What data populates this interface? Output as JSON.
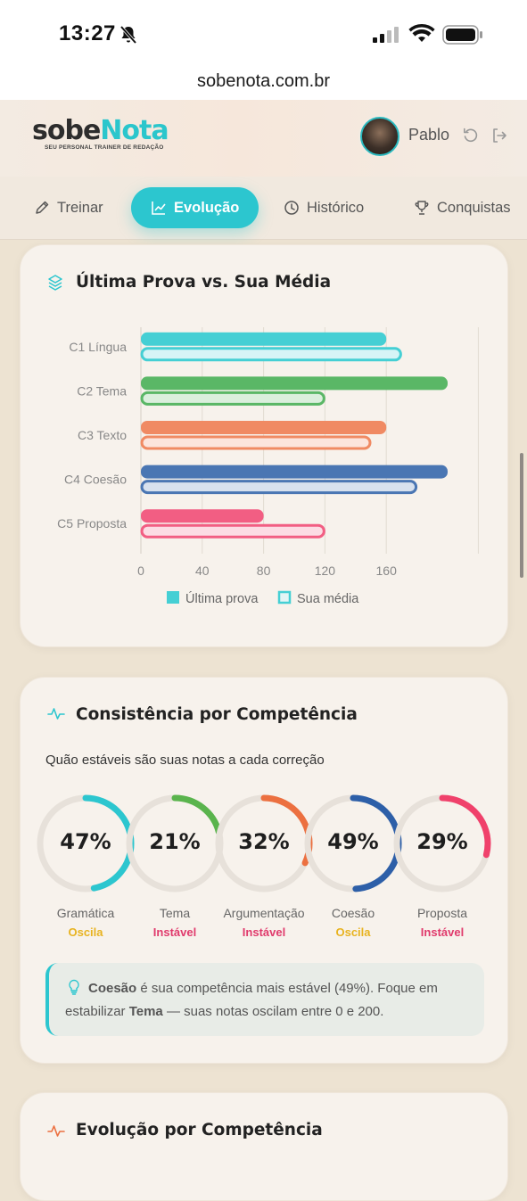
{
  "status_bar": {
    "time": "13:27"
  },
  "browser": {
    "url": "sobenota.com.br"
  },
  "header": {
    "logo_sobe": "sobe",
    "logo_nota": "Nota",
    "logo_tagline": "SEU PERSONAL TRAINER DE REDAÇÃO",
    "user_name": "Pablo"
  },
  "tabs": [
    {
      "label": "Treinar",
      "icon": "pencil-icon",
      "active": false
    },
    {
      "label": "Evolução",
      "icon": "trend-chart-icon",
      "active": true
    },
    {
      "label": "Histórico",
      "icon": "clock-icon",
      "active": false
    },
    {
      "label": "Conquistas",
      "icon": "trophy-icon",
      "active": false
    }
  ],
  "comparison_card": {
    "title": "Última Prova vs. Sua Média",
    "icon": "layers-icon"
  },
  "chart_data": {
    "type": "bar",
    "orientation": "horizontal",
    "categories": [
      "C1 Língua",
      "C2 Tema",
      "C3 Texto",
      "C4 Coesão",
      "C5 Proposta"
    ],
    "series": [
      {
        "name": "Última prova",
        "values": [
          160,
          200,
          160,
          200,
          80
        ]
      },
      {
        "name": "Sua média",
        "values": [
          170,
          120,
          150,
          180,
          120
        ]
      }
    ],
    "colors": [
      "#45cfd4",
      "#5ab766",
      "#f08a63",
      "#4a76b3",
      "#f25e83"
    ],
    "xticks": [
      0,
      40,
      80,
      120,
      160
    ],
    "xlim": [
      0,
      220
    ],
    "grid": true,
    "legend_position": "bottom"
  },
  "consistency_card": {
    "title": "Consistência por Competência",
    "icon": "pulse-icon",
    "subtitle": "Quão estáveis são suas notas a cada correção",
    "rings": [
      {
        "name": "Gramática",
        "pct_label": "47%",
        "value": 47,
        "status": "Oscila",
        "color": "#2cc6cf",
        "status_color": "#e8b320"
      },
      {
        "name": "Tema",
        "pct_label": "21%",
        "value": 21,
        "status": "Instável",
        "color": "#5ab44d",
        "status_color": "#e03a6c"
      },
      {
        "name": "Argumentação",
        "pct_label": "32%",
        "value": 32,
        "status": "Instável",
        "color": "#ec7040",
        "status_color": "#e03a6c"
      },
      {
        "name": "Coesão",
        "pct_label": "49%",
        "value": 49,
        "status": "Oscila",
        "color": "#2d5fa8",
        "status_color": "#e8b320"
      },
      {
        "name": "Proposta",
        "pct_label": "29%",
        "value": 29,
        "status": "Instável",
        "color": "#f0416b",
        "status_color": "#e03a6c"
      }
    ],
    "tip": {
      "icon": "lightbulb-icon",
      "strong1": "Coesão",
      "text1": " é sua competência mais estável (49%). Foque em estabilizar ",
      "strong2": "Tema",
      "text2": " — suas notas oscilam entre 0 e 200."
    }
  },
  "evolution_card": {
    "title": "Evolução por Competência",
    "icon": "pulse-icon"
  }
}
